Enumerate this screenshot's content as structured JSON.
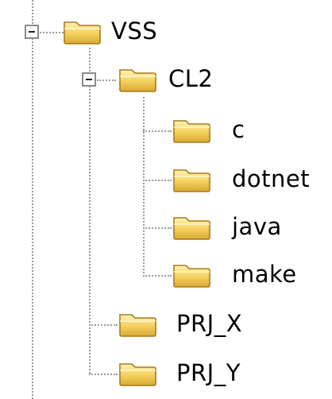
{
  "tree": {
    "nodes": [
      {
        "label": "VSS",
        "expanded": true
      },
      {
        "label": "CL2",
        "expanded": true
      },
      {
        "label": "c"
      },
      {
        "label": "dotnet"
      },
      {
        "label": "java"
      },
      {
        "label": "make"
      },
      {
        "label": "PRJ_X"
      },
      {
        "label": "PRJ_Y"
      }
    ]
  },
  "colors": {
    "folder_fill": "#f6d56a",
    "folder_dark": "#c89a2a",
    "connector": "#9a9a9a"
  }
}
